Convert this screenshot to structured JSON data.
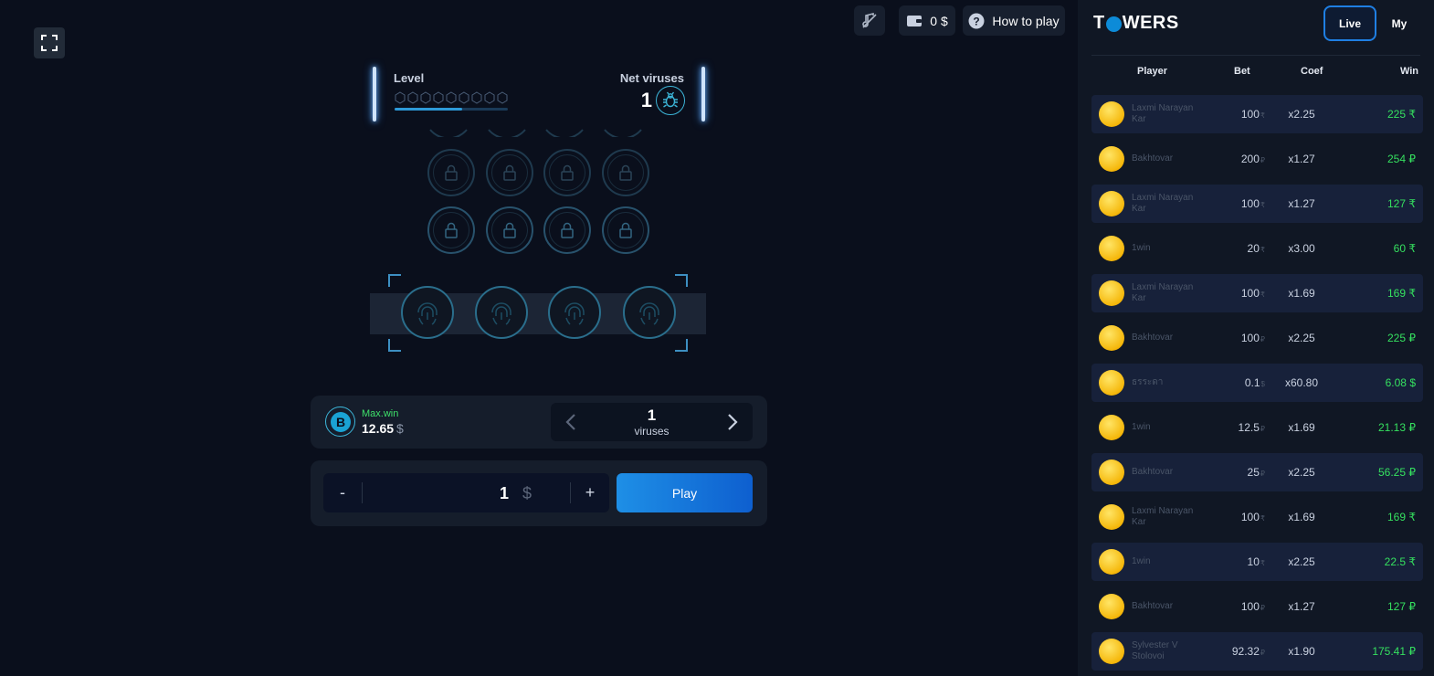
{
  "top": {
    "wallet_balance": "0 $",
    "how_to_play": "How to play"
  },
  "level_panel": {
    "level_label": "Level",
    "net_viruses_label": "Net viruses",
    "net_viruses_value": "1",
    "level_progress": 0.6
  },
  "info": {
    "maxwin_label": "Max.win",
    "maxwin_value": "12.65",
    "maxwin_currency": "$",
    "virus_count": "1",
    "virus_word": "viruses"
  },
  "bet": {
    "minus": "-",
    "plus": "+",
    "amount": "1",
    "currency": "$",
    "play_label": "Play"
  },
  "sidebar": {
    "logo_pre": "T",
    "logo_post": "WERS",
    "tab_live": "Live",
    "tab_my": "My",
    "columns": {
      "player": "Player",
      "bet": "Bet",
      "coef": "Coef",
      "win": "Win"
    },
    "rows": [
      {
        "player": "Laxmi Narayan Kar",
        "bet": "100",
        "bet_cur": "₹",
        "coef": "x2.25",
        "win": "225 ₹"
      },
      {
        "player": "Bakhtovar",
        "bet": "200",
        "bet_cur": "₽",
        "coef": "x1.27",
        "win": "254 ₽"
      },
      {
        "player": "Laxmi Narayan Kar",
        "bet": "100",
        "bet_cur": "₹",
        "coef": "x1.27",
        "win": "127 ₹"
      },
      {
        "player": "1win",
        "bet": "20",
        "bet_cur": "₹",
        "coef": "x3.00",
        "win": "60 ₹"
      },
      {
        "player": "Laxmi Narayan Kar",
        "bet": "100",
        "bet_cur": "₹",
        "coef": "x1.69",
        "win": "169 ₹"
      },
      {
        "player": "Bakhtovar",
        "bet": "100",
        "bet_cur": "₽",
        "coef": "x2.25",
        "win": "225 ₽"
      },
      {
        "player": "ธรระดา",
        "bet": "0.1",
        "bet_cur": "$",
        "coef": "x60.80",
        "win": "6.08 $"
      },
      {
        "player": "1win",
        "bet": "12.5",
        "bet_cur": "₽",
        "coef": "x1.69",
        "win": "21.13 ₽"
      },
      {
        "player": "Bakhtovar",
        "bet": "25",
        "bet_cur": "₽",
        "coef": "x2.25",
        "win": "56.25 ₽"
      },
      {
        "player": "Laxmi Narayan Kar",
        "bet": "100",
        "bet_cur": "₹",
        "coef": "x1.69",
        "win": "169 ₹"
      },
      {
        "player": "1win",
        "bet": "10",
        "bet_cur": "₹",
        "coef": "x2.25",
        "win": "22.5 ₹"
      },
      {
        "player": "Bakhtovar",
        "bet": "100",
        "bet_cur": "₽",
        "coef": "x1.27",
        "win": "127 ₽"
      },
      {
        "player": "Sylvester V Stolovoi",
        "bet": "92.32",
        "bet_cur": "₽",
        "coef": "x1.90",
        "win": "175.41 ₽"
      }
    ]
  },
  "icons": {
    "fullscreen": "fullscreen-icon",
    "sound": "sound-off-icon",
    "wallet": "wallet-icon",
    "help": "question-icon",
    "bug": "bug-icon",
    "bitcoin": "bitcoin-icon",
    "lock": "lock-icon",
    "fingerprint": "fingerprint-icon"
  },
  "colors": {
    "accent_blue": "#1e8fe6",
    "win_green": "#35e05f",
    "maxwin_green": "#3ee06a",
    "cyan": "#3cb5d8"
  }
}
